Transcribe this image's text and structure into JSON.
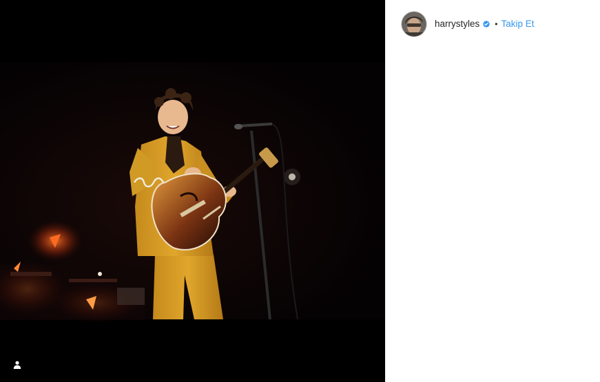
{
  "post": {
    "username": "harrystyles",
    "separator": "•",
    "follow_label": "Takip Et",
    "verified": true
  },
  "media": {
    "tag_icon": "person-icon"
  },
  "colors": {
    "link": "#3897f0",
    "verified": "#3897f0",
    "media_background": "#000000"
  }
}
